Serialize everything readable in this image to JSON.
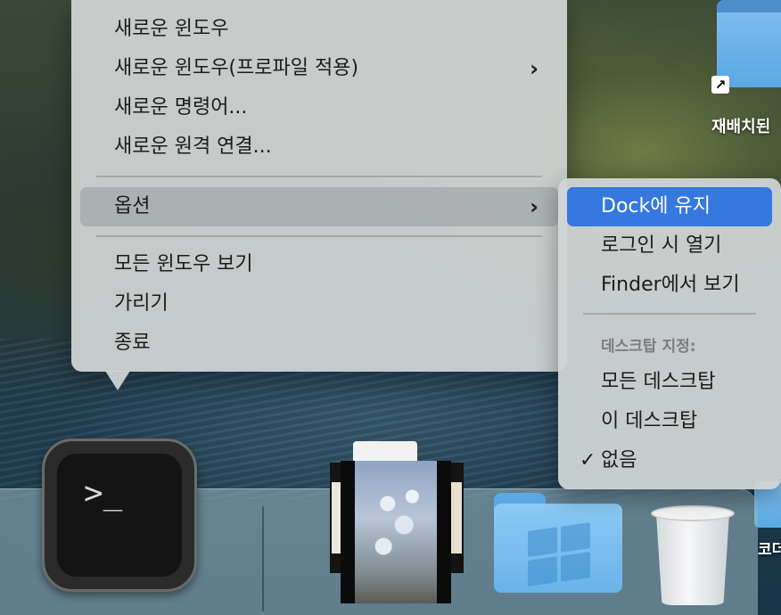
{
  "desktop": {
    "alias_icon_label": "재배치된",
    "bottom_item_label": "코더",
    "alias_arrow": "alias-arrow-icon"
  },
  "menu": {
    "items": [
      {
        "label": "새로운 윈도우"
      },
      {
        "label": "새로운 윈도우(프로파일 적용)",
        "has_submenu": true
      },
      {
        "label": "새로운 명령어..."
      },
      {
        "label": "새로운 원격 연결..."
      },
      {
        "label": "옵션",
        "has_submenu": true,
        "highlighted": true
      },
      {
        "label": "모든 윈도우 보기"
      },
      {
        "label": "가리기"
      },
      {
        "label": "종료"
      }
    ],
    "chevron": "›"
  },
  "submenu": {
    "items": [
      {
        "label": "Dock에 유지",
        "selected": true
      },
      {
        "label": "로그인 시 열기"
      },
      {
        "label": "Finder에서 보기"
      }
    ],
    "heading": "데스크탑 지정:",
    "assign_options": [
      {
        "label": "모든 데스크탑"
      },
      {
        "label": "이 데스크탑"
      },
      {
        "label": "없음",
        "checked": true
      }
    ],
    "check_mark": "✓",
    "selection_color": "#3478e0"
  },
  "dock": {
    "terminal_prompt": ">_",
    "apps": [
      "terminal-app-icon",
      "photos-stack-icon",
      "windows-folder-icon",
      "trash-icon"
    ]
  }
}
